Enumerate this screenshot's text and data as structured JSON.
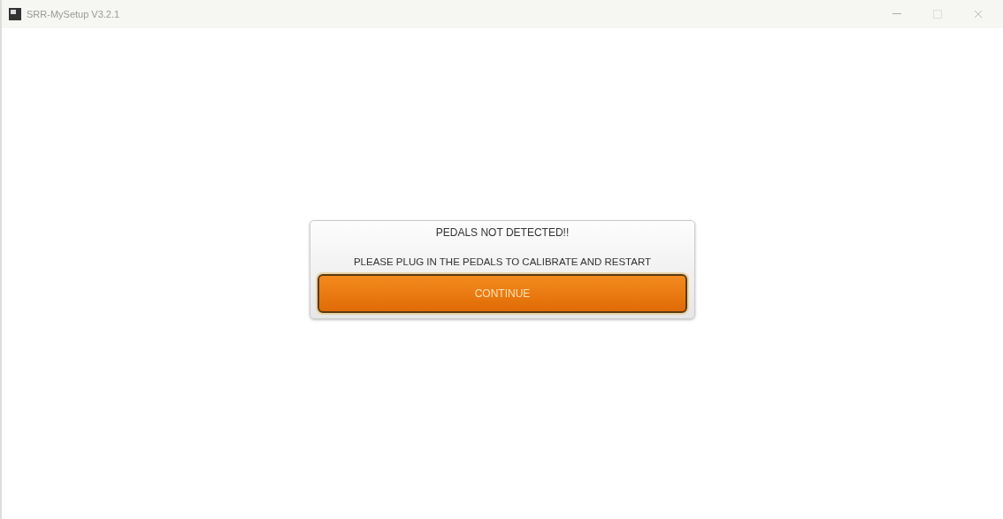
{
  "window": {
    "title": "SRR-MySetup V3.2.1"
  },
  "dialog": {
    "title": "PEDALS NOT DETECTED!!",
    "message": "PLEASE PLUG IN THE PEDALS TO CALIBRATE AND RESTART",
    "button": "CONTINUE"
  }
}
